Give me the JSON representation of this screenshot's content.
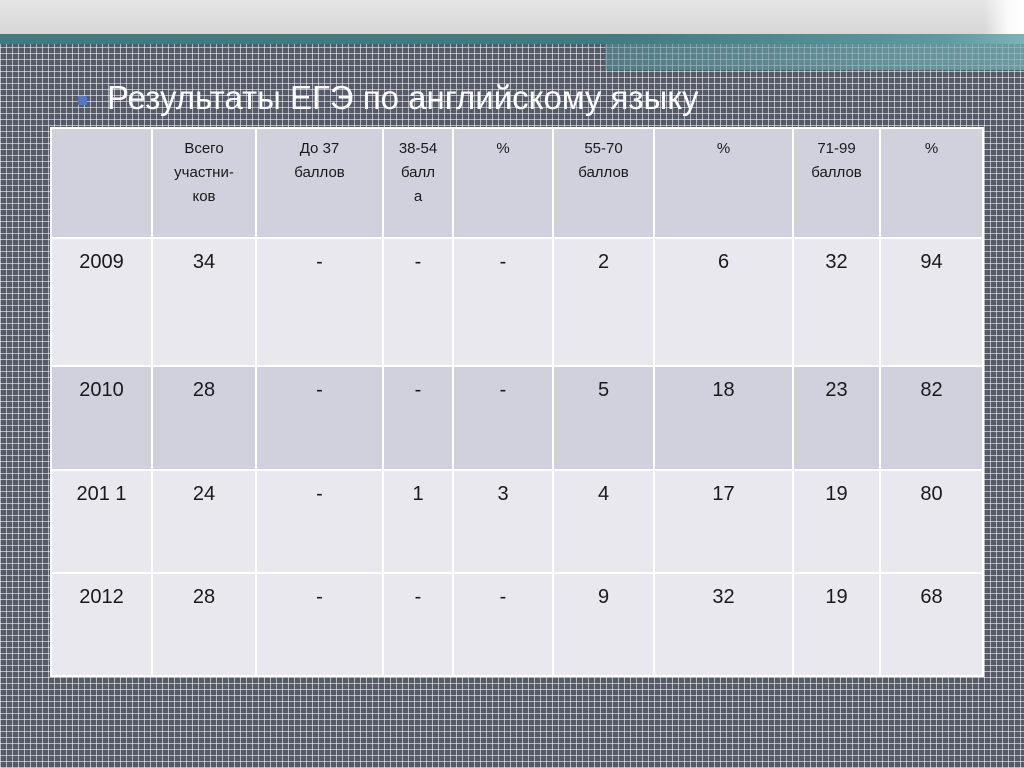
{
  "slide": {
    "title": "Результаты  ЕГЭ по английскому языку",
    "bullet_color": "#4f79c3",
    "accent_color": "#3f7b80"
  },
  "table": {
    "headers": [
      "",
      "Всего\nучастни-\nков",
      "До 37\nбаллов",
      "38-54\nбалл\nа",
      "%",
      "55-70\nбаллов",
      "%",
      "71-99\nбаллов",
      "%"
    ],
    "rows": [
      [
        "2009",
        "34",
        "-",
        "-",
        "-",
        "2",
        "6",
        "32",
        "94"
      ],
      [
        "2010",
        "28",
        "-",
        "-",
        "-",
        "5",
        "18",
        "23",
        "82"
      ],
      [
        "201 1",
        "24",
        "-",
        "1",
        "3",
        "4",
        "17",
        "19",
        "80"
      ],
      [
        "2012",
        "28",
        "-",
        "-",
        "-",
        "9",
        "32",
        "19",
        "68"
      ]
    ]
  }
}
